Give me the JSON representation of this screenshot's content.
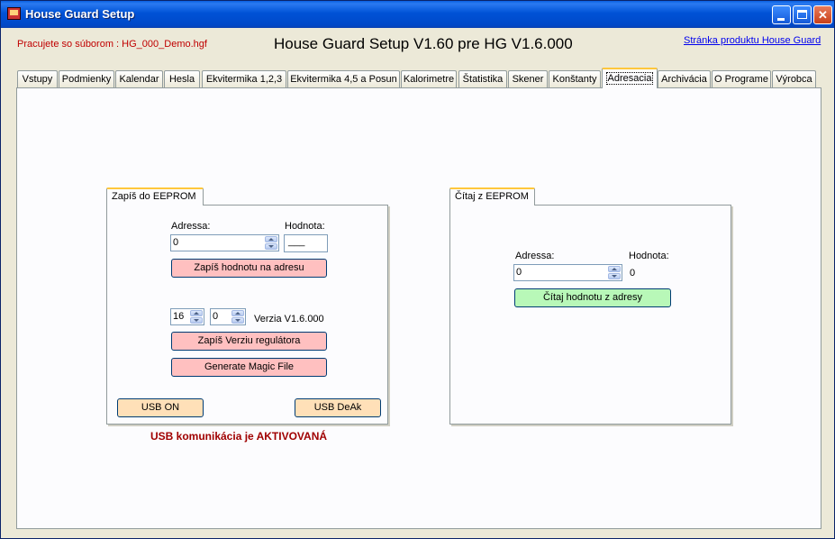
{
  "window": {
    "title": "House Guard Setup",
    "buttons": {
      "minimize": "minimize",
      "maximize": "maximize",
      "close": "✕"
    }
  },
  "header": {
    "file_label": "Pracujete so súborom : HG_000_Demo.hgf",
    "main_title": "House Guard Setup V1.60 pre HG V1.6.000",
    "product_link": "Stránka produktu House Guard"
  },
  "tabs": [
    "Vstupy",
    "Podmienky",
    "Kalendar",
    "Hesla",
    "Ekvitermika 1,2,3",
    "Ekvitermika 4,5 a Posun",
    "Kalorimetre",
    "Štatistika",
    "Skener",
    "Konštanty",
    "Adresacia",
    "Archivácia",
    "O Programe",
    "Výrobca"
  ],
  "active_tab": "Adresacia",
  "write_group": {
    "title": "Zapíš do EEPROM",
    "address_label": "Adressa:",
    "address_value": "0",
    "value_label": "Hodnota:",
    "value_value": "___",
    "write_button": "Zapíš hodnotu na adresu",
    "version_major": "16",
    "version_minor": "0",
    "version_label": "Verzia V1.6.000",
    "write_version_button": "Zapíš Verziu regulátora",
    "magic_button": "Generate Magic File",
    "usb_on_button": "USB ON",
    "usb_deak_button": "USB DeAk"
  },
  "usb_status": "USB komunikácia je AKTIVOVANÁ",
  "read_group": {
    "title": "Čítaj z EEPROM",
    "address_label": "Adressa:",
    "address_value": "0",
    "value_label": "Hodnota:",
    "value_value": "0",
    "read_button": "Čítaj hodnotu z adresy"
  },
  "colors": {
    "titlebar": "#0052d6",
    "pink_button": "#ffc0c0",
    "peach_button": "#ffe0b8",
    "green_button": "#b8f8b8",
    "status_text": "#a00000",
    "file_label": "#c00000"
  }
}
